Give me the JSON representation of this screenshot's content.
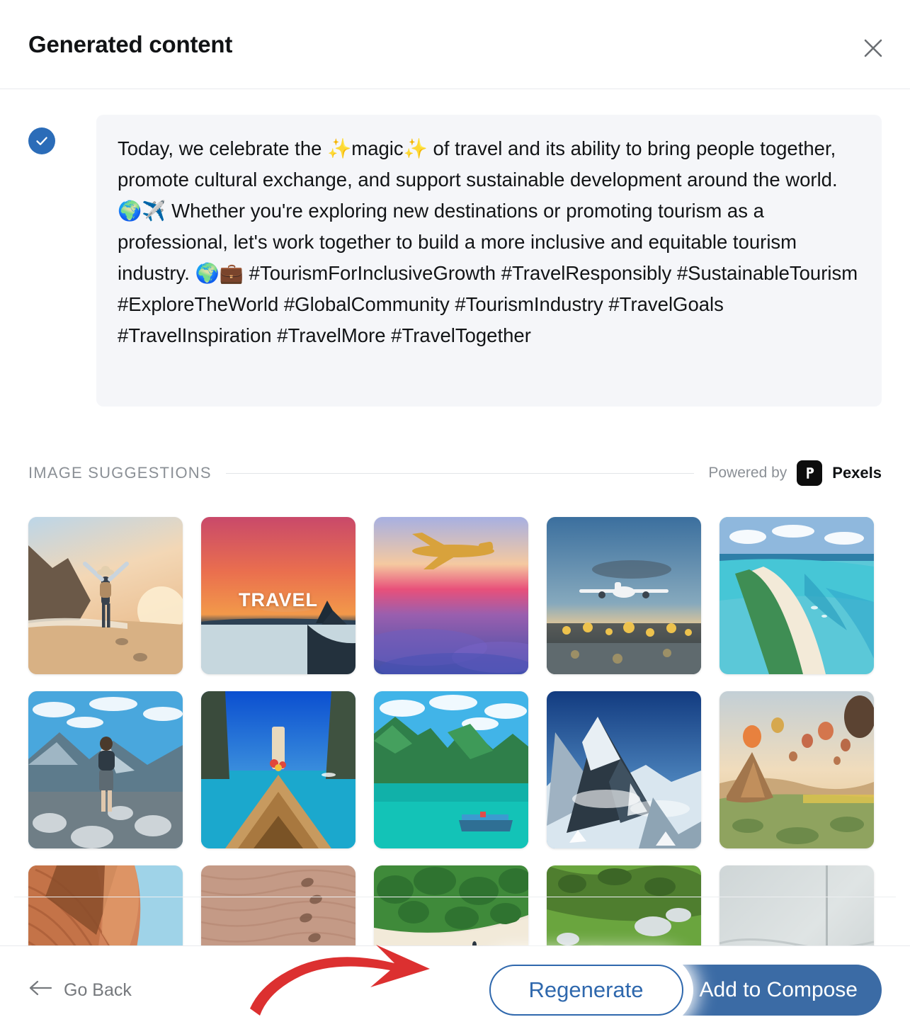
{
  "header": {
    "title": "Generated content",
    "close_icon": "close-icon"
  },
  "content": {
    "selected_icon": "check-circle-icon",
    "text": "Today, we celebrate the ✨magic✨ of travel and its ability to bring people together, promote cultural exchange, and support sustainable development around the world. 🌍✈️ Whether you're exploring new destinations or promoting tourism as a professional, let's work together to build a more inclusive and equitable tourism industry. 🌍💼 #TourismForInclusiveGrowth #TravelResponsibly #SustainableTourism #ExploreTheWorld #GlobalCommunity #TourismIndustry #TravelGoals #TravelInspiration #TravelMore #TravelTogether"
  },
  "suggestions": {
    "label": "IMAGE SUGGESTIONS",
    "powered_by_text": "Powered by",
    "provider_name": "Pexels",
    "provider_icon": "pexels-logo-icon",
    "images": [
      {
        "name": "traveler-arms-raised-beach-sunset",
        "caption": ""
      },
      {
        "name": "travel-word-orange-sunset-lake",
        "caption": "TRAVEL"
      },
      {
        "name": "airplane-over-purple-sunset-clouds",
        "caption": ""
      },
      {
        "name": "airplane-landing-over-city-lights",
        "caption": ""
      },
      {
        "name": "turquoise-lagoon-sandbar-aerial",
        "caption": ""
      },
      {
        "name": "hiker-backpack-mountain-viewpoint",
        "caption": ""
      },
      {
        "name": "longtail-boat-bow-blue-sea",
        "caption": ""
      },
      {
        "name": "limestone-karst-green-lagoon",
        "caption": ""
      },
      {
        "name": "snow-capped-mountain-peak",
        "caption": ""
      },
      {
        "name": "hot-air-balloons-cappadocia",
        "caption": ""
      },
      {
        "name": "red-sandstone-canyon-wave",
        "caption": ""
      },
      {
        "name": "footprints-in-desert-sand",
        "caption": ""
      },
      {
        "name": "palm-trees-white-sand-beach-aerial",
        "caption": ""
      },
      {
        "name": "children-on-green-alpine-meadow",
        "caption": ""
      },
      {
        "name": "suitcase-handle-plain-background",
        "caption": ""
      }
    ]
  },
  "footer": {
    "go_back_label": "Go Back",
    "go_back_icon": "arrow-left-icon",
    "regenerate_label": "Regenerate",
    "add_to_compose_label": "Add to Compose"
  },
  "annotation": {
    "arrow_icon": "red-curved-arrow-icon",
    "arrow_color": "#dc3030",
    "points_to": "regenerate-button"
  },
  "colors": {
    "accent_blue": "#2f68ad",
    "primary_button": "#3b6ba5",
    "check_badge": "#2b6cb8",
    "content_box_bg": "#f5f6f9",
    "muted_text": "#8b9096"
  }
}
